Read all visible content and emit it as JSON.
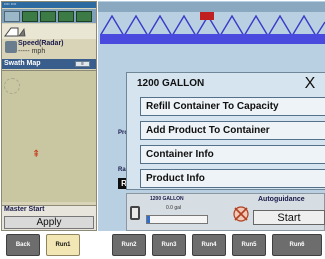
{
  "status_bar": {
    "text": "•••• ••••"
  },
  "toolbar": {
    "icons": [
      "grid-icon",
      "field-icon",
      "tractor-icon",
      "sprayer-icon",
      "settings-icon"
    ]
  },
  "speed": {
    "label": "Speed(Radar)",
    "value": "----- mph"
  },
  "swath_map": {
    "label": "Swath Map",
    "button_label": "≡"
  },
  "map": {
    "vehicle_glyph": "⇞"
  },
  "master_start": {
    "label": "Master Start",
    "apply_label": "Apply"
  },
  "background": {
    "product_caption": "Pro",
    "rate_caption": "Ra",
    "run_label": "R"
  },
  "popup": {
    "title": "1200 GALLON",
    "close_label": "X",
    "items": [
      {
        "label": "Refill Container To Capacity"
      },
      {
        "label": "Add Product To Container"
      },
      {
        "label": "Container Info"
      },
      {
        "label": "Product Info"
      }
    ]
  },
  "tank": {
    "title": "1200 GALLON",
    "sub": "0.0 gal",
    "level": 0.05
  },
  "autoguidance": {
    "label": "Autoguidance",
    "start_label": "Start"
  },
  "tabs": [
    "Back",
    "Run1",
    "Run2",
    "Run3",
    "Run4",
    "Run5",
    "Run6"
  ],
  "active_tab": "Run1",
  "colors": {
    "accent": "#3a5e8c",
    "tank_fill": "#2f6fd1",
    "tab_active": "#f1e6b4",
    "tab_inactive": "#6d6d6d"
  }
}
